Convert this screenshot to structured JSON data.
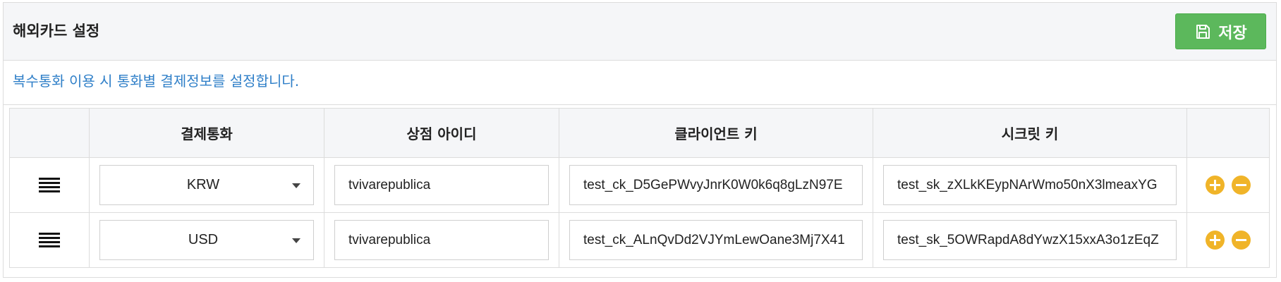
{
  "header": {
    "title": "해외카드 설정",
    "save_label": "저장"
  },
  "description": "복수통화 이용 시 통화별 결제정보를 설정합니다.",
  "table": {
    "columns": [
      "",
      "결제통화",
      "상점 아이디",
      "클라이언트 키",
      "시크릿 키",
      ""
    ],
    "rows": [
      {
        "currency": "KRW",
        "merchant_id": "tvivarepublica",
        "client_key": "test_ck_D5GePWvyJnrK0W0k6q8gLzN97E",
        "secret_key": "test_sk_zXLkKEypNArWmo50nX3lmeaxYG"
      },
      {
        "currency": "USD",
        "merchant_id": "tvivarepublica",
        "client_key": "test_ck_ALnQvDd2VJYmLewOane3Mj7X41",
        "secret_key": "test_sk_5OWRapdA8dYwzX15xxA3o1zEqZ"
      }
    ]
  },
  "icons": {
    "save": "floppy-disk-icon",
    "handle": "drag-handle-icon",
    "add": "plus-circle-icon",
    "remove": "minus-circle-icon"
  },
  "colors": {
    "save_button": "#5cb85c",
    "description_text": "#2f7fc8",
    "action_buttons": "#f0b429",
    "header_bg": "#f5f6f8"
  }
}
